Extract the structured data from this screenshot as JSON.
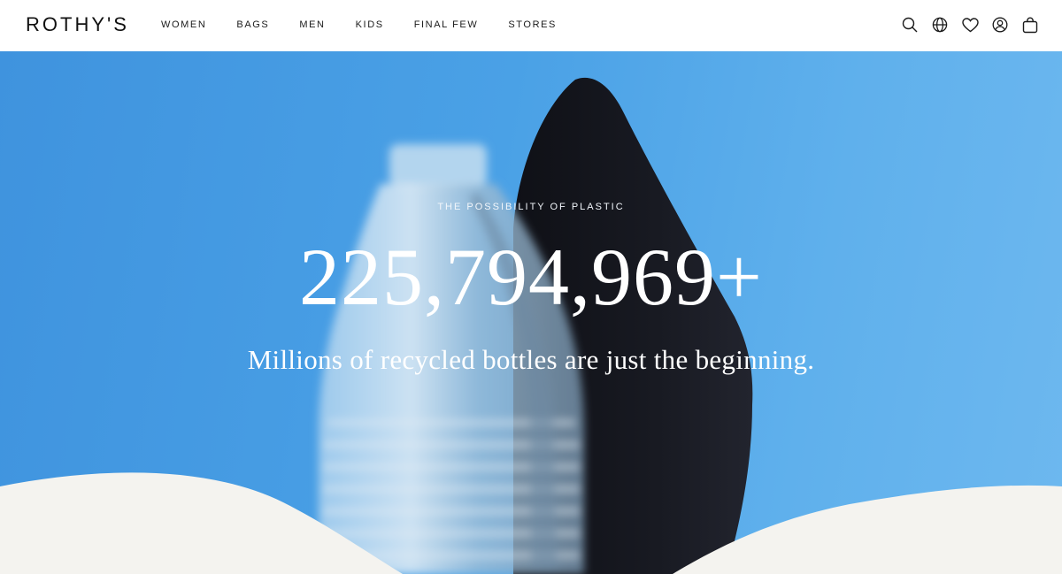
{
  "brand": {
    "logo": "ROTHY'S"
  },
  "nav": {
    "items": [
      "WOMEN",
      "BAGS",
      "MEN",
      "KIDS",
      "FINAL FEW",
      "STORES"
    ]
  },
  "header_icons": [
    "search-icon",
    "globe-icon",
    "heart-icon",
    "account-icon",
    "bag-icon"
  ],
  "hero": {
    "eyebrow": "THE POSSIBILITY OF PLASTIC",
    "count": "225,794,969+",
    "tagline": "Millions of recycled bottles are just the beginning."
  },
  "colors": {
    "sky_blue": "#4aa1e6",
    "shoe_black": "#15161c",
    "cream_wave": "#f4f3ef",
    "text_dark": "#111111"
  }
}
